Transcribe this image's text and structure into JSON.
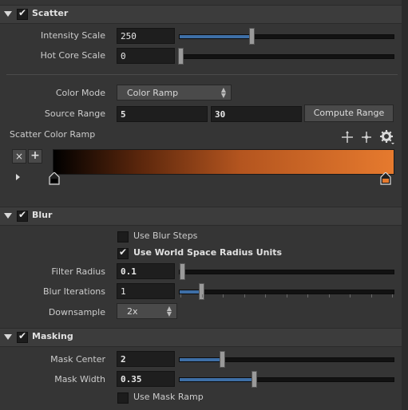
{
  "scatter": {
    "title": "Scatter",
    "intensity_scale": {
      "label": "Intensity Scale",
      "value": "250",
      "slider": 0.33
    },
    "hot_core_scale": {
      "label": "Hot Core Scale",
      "value": "0",
      "slider": 0.0
    },
    "color_mode": {
      "label": "Color Mode",
      "value": "Color Ramp"
    },
    "source_range": {
      "label": "Source Range",
      "min": "5",
      "max": "30",
      "button": "Compute Range"
    },
    "ramp": {
      "label": "Scatter Color Ramp",
      "remove_button": "×",
      "add_button": "+",
      "start_color": "#000000",
      "end_color": "#e67a2e"
    }
  },
  "blur": {
    "title": "Blur",
    "use_blur_steps": {
      "label": "Use Blur Steps",
      "checked": false
    },
    "use_world_space": {
      "label": "Use World Space Radius Units",
      "checked": true
    },
    "filter_radius": {
      "label": "Filter Radius",
      "value": "0.1",
      "slider": 0.0
    },
    "blur_iterations": {
      "label": "Blur Iterations",
      "value": "1",
      "slider": 0.1
    },
    "downsample": {
      "label": "Downsample",
      "value": "2x"
    }
  },
  "masking": {
    "title": "Masking",
    "mask_center": {
      "label": "Mask Center",
      "value": "2",
      "slider": 0.2
    },
    "mask_width": {
      "label": "Mask Width",
      "value": "0.35",
      "slider": 0.35
    },
    "use_mask_ramp": {
      "label": "Use Mask Ramp",
      "checked": false
    }
  },
  "colors": {
    "accent": "#3e6fa6",
    "panel": "#353535"
  }
}
